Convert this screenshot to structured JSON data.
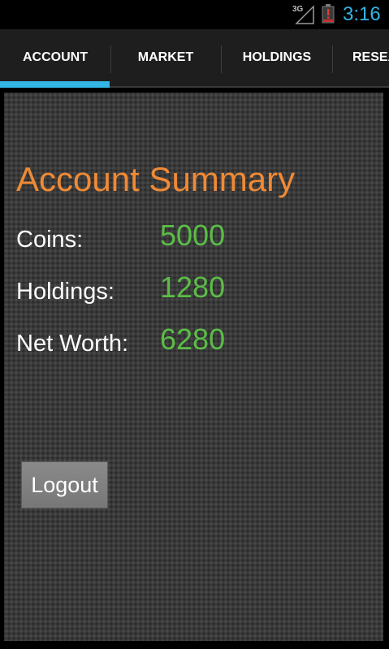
{
  "status_bar": {
    "network_label": "3G",
    "time": "3:16",
    "network_icon": "signal-3g-icon",
    "battery_icon": "battery-low-icon",
    "clock_color": "#33b5e5",
    "battery_alert_color": "#c9302c"
  },
  "tabs": [
    {
      "label": "ACCOUNT",
      "selected": true
    },
    {
      "label": "MARKET",
      "selected": false
    },
    {
      "label": "HOLDINGS",
      "selected": false
    },
    {
      "label": "RESEA",
      "selected": false
    }
  ],
  "accent_color": "#33b5e5",
  "account": {
    "title": "Account Summary",
    "title_color": "#f08a35",
    "value_color": "#5bbd47",
    "rows": [
      {
        "label": "Coins:",
        "value": "5000"
      },
      {
        "label": "Holdings:",
        "value": "1280"
      },
      {
        "label": "Net Worth:",
        "value": "6280"
      }
    ],
    "logout_label": "Logout"
  }
}
